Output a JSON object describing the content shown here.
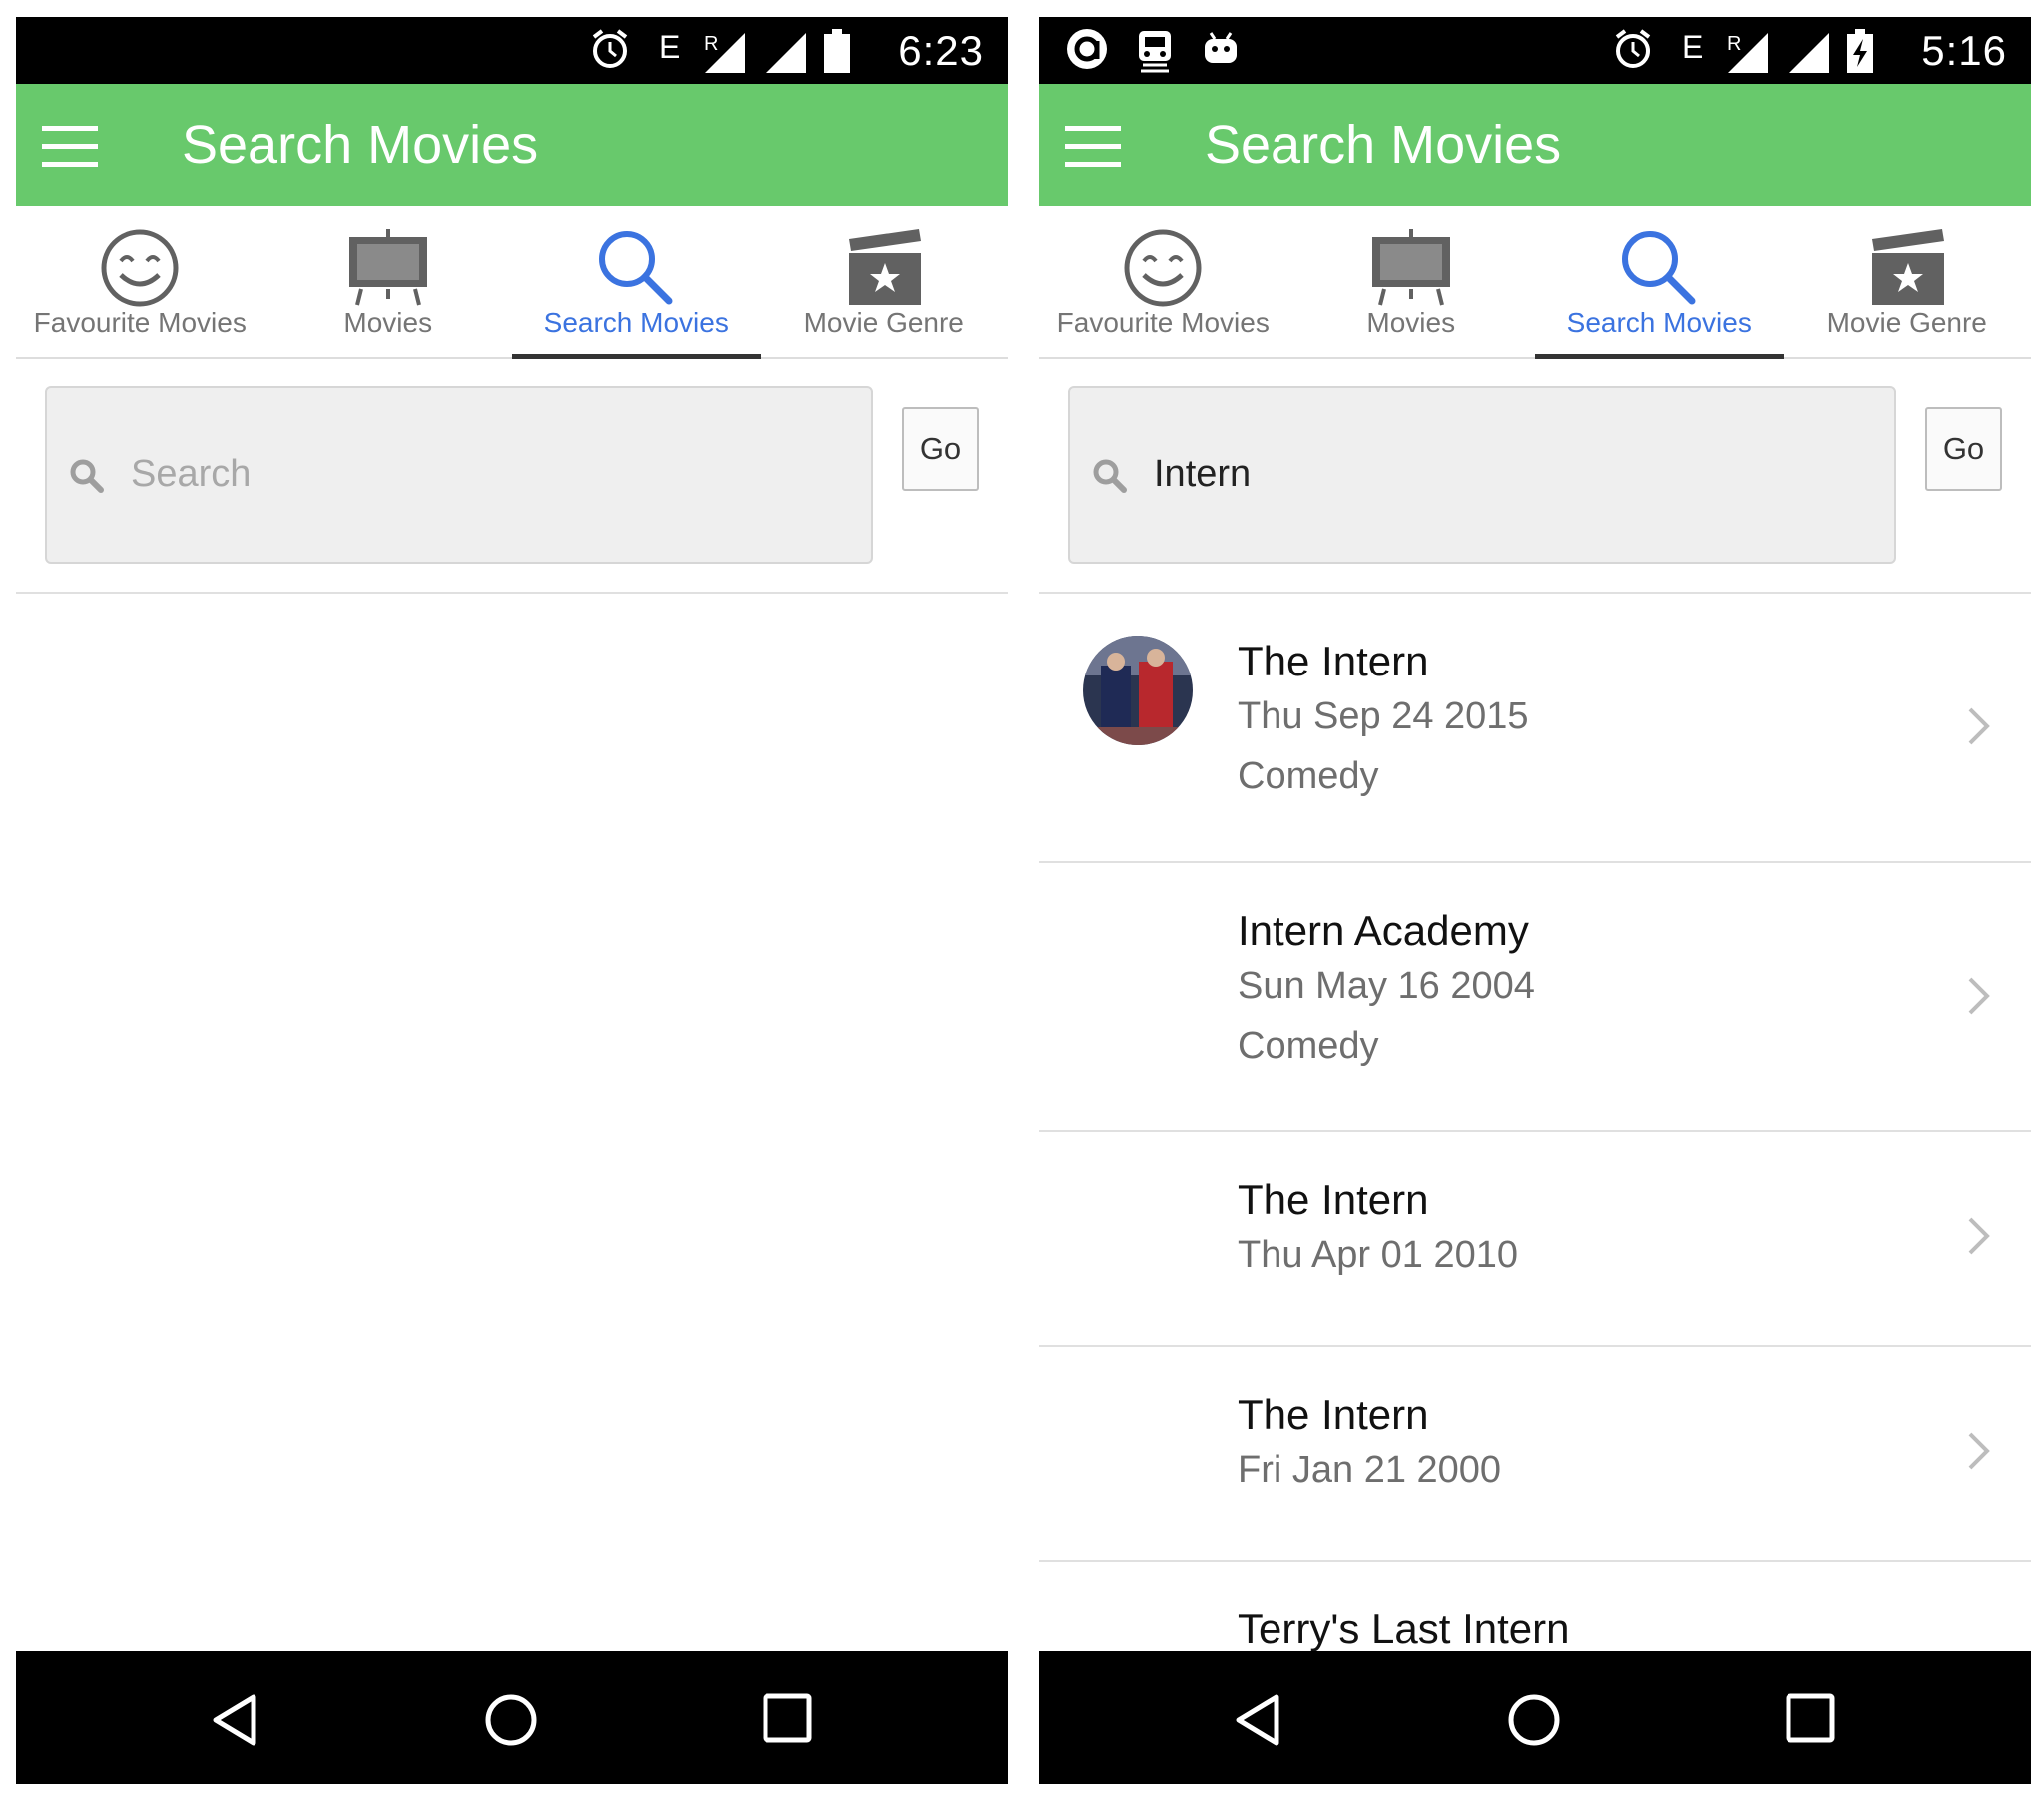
{
  "left": {
    "status": {
      "time": "6:23",
      "network": "E",
      "roaming": "R"
    },
    "appbar": {
      "title": "Search Movies"
    },
    "tabs": [
      {
        "label": "Favourite Movies",
        "icon": "smiley-icon"
      },
      {
        "label": "Movies",
        "icon": "tv-icon"
      },
      {
        "label": "Search Movies",
        "icon": "search-icon",
        "active": true
      },
      {
        "label": "Movie Genre",
        "icon": "clapperboard-icon"
      }
    ],
    "search": {
      "placeholder": "Search",
      "value": "",
      "go_label": "Go"
    }
  },
  "right": {
    "status": {
      "time": "5:16",
      "network": "E",
      "roaming": "R"
    },
    "appbar": {
      "title": "Search Movies"
    },
    "tabs": [
      {
        "label": "Favourite Movies",
        "icon": "smiley-icon"
      },
      {
        "label": "Movies",
        "icon": "tv-icon"
      },
      {
        "label": "Search Movies",
        "icon": "search-icon",
        "active": true
      },
      {
        "label": "Movie Genre",
        "icon": "clapperboard-icon"
      }
    ],
    "search": {
      "placeholder": "Search",
      "value": "Intern",
      "go_label": "Go"
    },
    "results": [
      {
        "title": "The Intern",
        "date": "Thu Sep 24 2015",
        "genre": "Comedy"
      },
      {
        "title": "Intern Academy",
        "date": "Sun May 16 2004",
        "genre": "Comedy"
      },
      {
        "title": "The Intern",
        "date": "Thu Apr 01 2010"
      },
      {
        "title": "The Intern",
        "date": "Fri Jan 21 2000"
      },
      {
        "title": "Terry's Last Intern"
      }
    ]
  },
  "colors": {
    "appbar": "#68c96c",
    "active_tab": "#3b73e0",
    "tab_icon": "#616161",
    "statusbar": "#000000"
  }
}
